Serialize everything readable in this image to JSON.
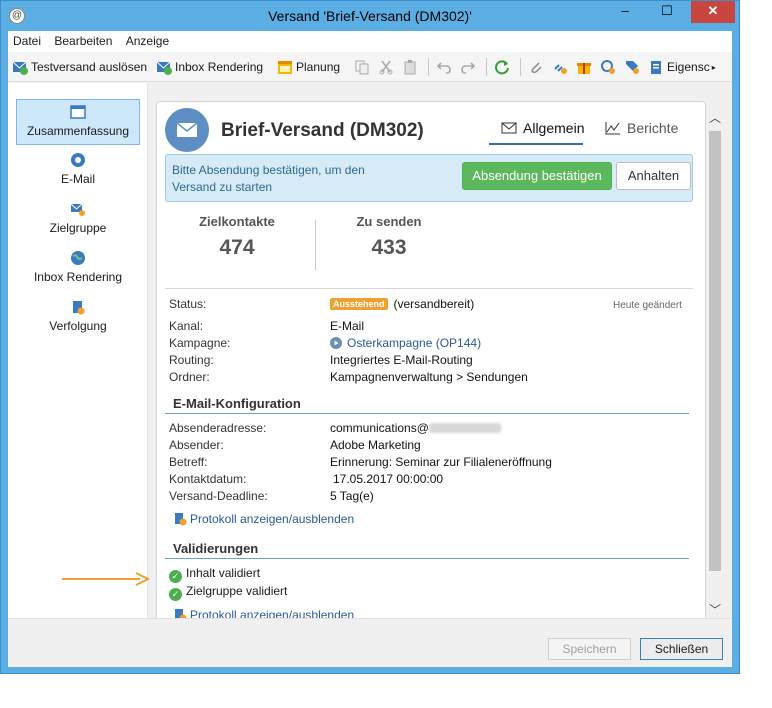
{
  "window": {
    "title": "Versand 'Brief-Versand (DM302)'",
    "minimize": "–",
    "maximize": "☐",
    "close": "✕"
  },
  "menu": [
    "Datei",
    "Bearbeiten",
    "Anzeige"
  ],
  "toolbar": {
    "testversand": "Testversand auslösen",
    "inbox_rendering": "Inbox Rendering",
    "planung": "Planung",
    "eigenschaften": "Eigensc"
  },
  "sidebar": {
    "items": [
      {
        "label": "Zusammenfassung",
        "icon": "summary-icon"
      },
      {
        "label": "E-Mail",
        "icon": "email-icon"
      },
      {
        "label": "Zielgruppe",
        "icon": "target-icon"
      },
      {
        "label": "Inbox Rendering",
        "icon": "globe-icon"
      },
      {
        "label": "Verfolgung",
        "icon": "tracking-icon"
      }
    ]
  },
  "header": {
    "title": "Brief-Versand (DM302)",
    "tab_general": "Allgemein",
    "tab_reports": "Berichte"
  },
  "alert": {
    "text": "Bitte Absendung bestätigen, um den Versand zu starten",
    "confirm_button": "Absendung bestätigen",
    "pause_button": "Anhalten"
  },
  "stats": {
    "contacts_label": "Zielkontakte",
    "contacts_value": "474",
    "to_send_label": "Zu senden",
    "to_send_value": "433"
  },
  "status": {
    "label": "Status:",
    "badge": "Ausstehend",
    "value": "(versandbereit)",
    "modified": "Heute geändert"
  },
  "details": [
    {
      "label": "Kanal:",
      "value": "E-Mail"
    },
    {
      "label": "Kampagne:",
      "value": "Osterkampagne (OP144)"
    },
    {
      "label": "Routing:",
      "value": "Integriertes E-Mail-Routing"
    },
    {
      "label": "Ordner:",
      "value": "Kampagnenverwaltung > Sendungen"
    }
  ],
  "email_config": {
    "title": "E-Mail-Konfiguration",
    "rows": [
      {
        "label": "Absenderadresse:",
        "value": "communications@"
      },
      {
        "label": "Absender:",
        "value": "Adobe Marketing"
      },
      {
        "label": "Betreff:",
        "value": "Erinnerung: Seminar zur Filialeneröffnung"
      },
      {
        "label": "Kontaktdatum:",
        "value": "17.05.2017 00:00:00"
      },
      {
        "label": "Versand-Deadline:",
        "value": "5 Tag(e)"
      }
    ],
    "log_link": "Protokoll anzeigen/ausblenden"
  },
  "validations": {
    "title": "Validierungen",
    "items": [
      "Inhalt validiert",
      "Zielgruppe validiert"
    ],
    "log_link": "Protokoll anzeigen/ausblenden"
  },
  "footer": {
    "save": "Speichern",
    "close": "Schließen"
  },
  "colors": {
    "titlebar": "#5aaee4",
    "confirm": "#5cb85c",
    "badge": "#f0a030",
    "arrow": "#f0a030"
  }
}
